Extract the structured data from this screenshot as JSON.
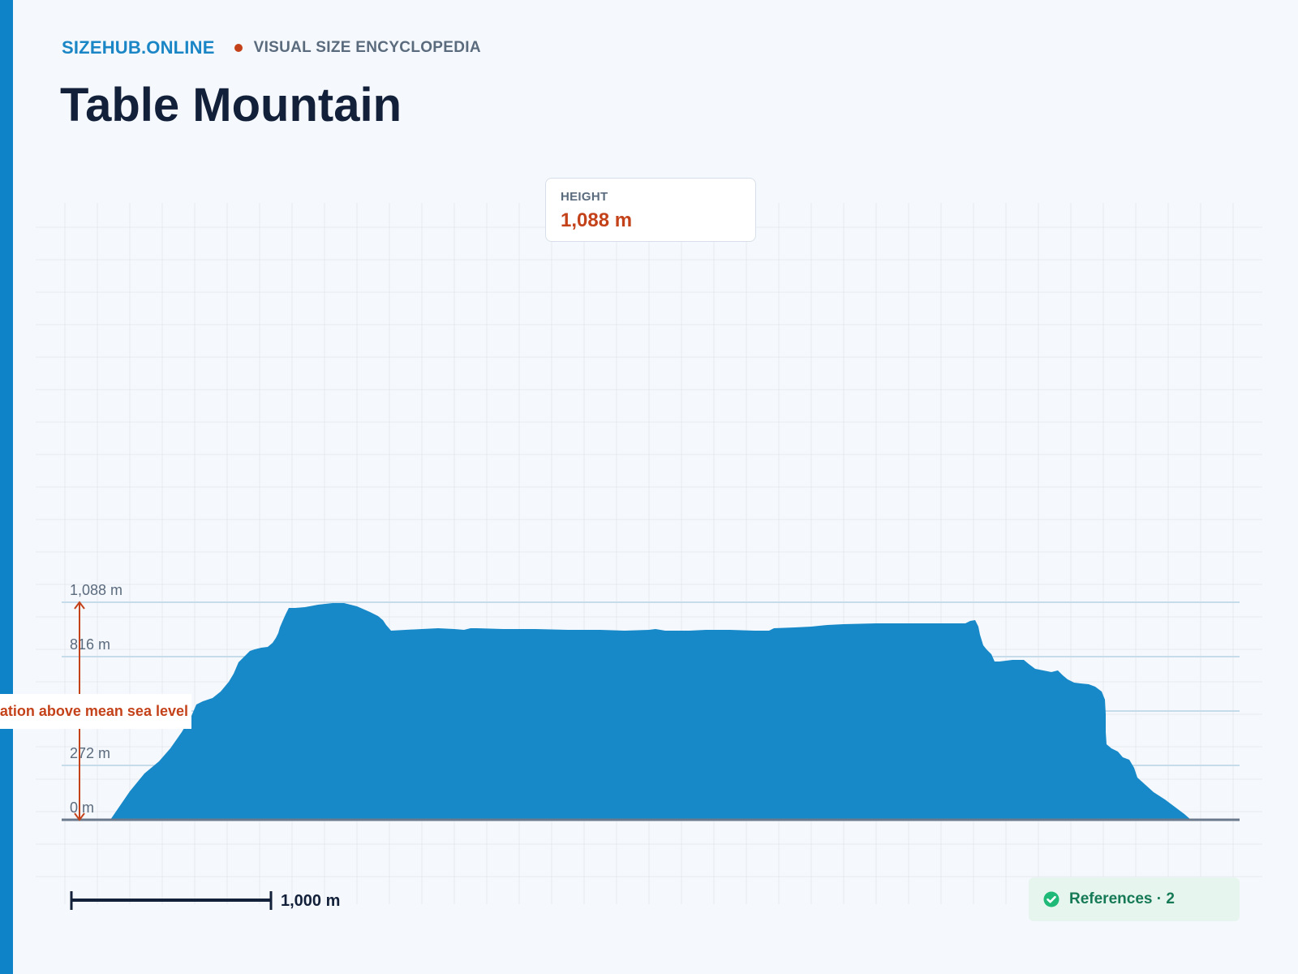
{
  "header": {
    "brand": "SIZEHUB.ONLINE",
    "tagline": "VISUAL SIZE ENCYCLOPEDIA"
  },
  "title": "Table Mountain",
  "height_card": {
    "label": "HEIGHT",
    "value": "1,088 m"
  },
  "chart_data": {
    "type": "area",
    "subject": "Table Mountain",
    "height_m": 1088,
    "y_unit": "m",
    "y_ticks": [
      {
        "value": 0,
        "label": "0 m"
      },
      {
        "value": 272,
        "label": "272 m"
      },
      {
        "value": 544,
        "label": ""
      },
      {
        "value": 816,
        "label": "816 m"
      },
      {
        "value": 1088,
        "label": "1,088 m"
      }
    ],
    "ylim": [
      0,
      1088
    ],
    "measurement_label": "elevation above mean sea level",
    "scale_bar": {
      "value": 1000,
      "label": "1,000 m"
    },
    "grid": true
  },
  "references": {
    "label": "References · 2",
    "icon": "check-circle-icon"
  },
  "colors": {
    "accent": "#0e83c8",
    "mountain_fill": "#1789c8",
    "highlight": "#c4421a",
    "title": "#13203a",
    "success": "#157a55"
  }
}
